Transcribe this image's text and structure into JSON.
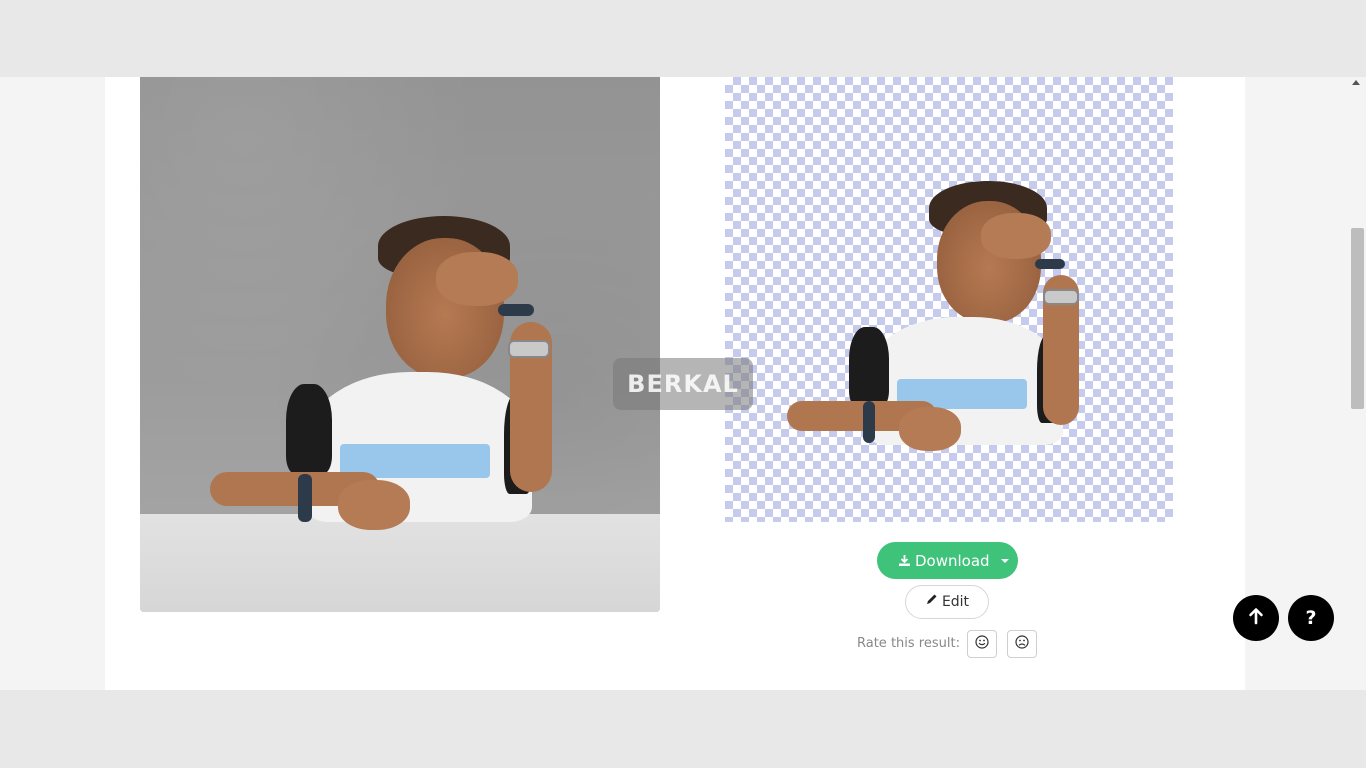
{
  "watermark": {
    "text": "BERKAL"
  },
  "result_actions": {
    "download_label": "Download",
    "edit_label": "Edit",
    "rate_label": "Rate this result:"
  },
  "floating": {
    "help_label": "?"
  },
  "colors": {
    "download_green": "#3fc27a",
    "checker_blue": "#c6cbee",
    "float_button": "#000000"
  },
  "icons": {
    "download": "download-icon",
    "dropdown": "caret-down-icon",
    "edit": "pencil-icon",
    "rate_good": "smile-icon",
    "rate_bad": "frown-icon",
    "scroll_top": "arrow-up-icon",
    "help": "question-icon"
  }
}
